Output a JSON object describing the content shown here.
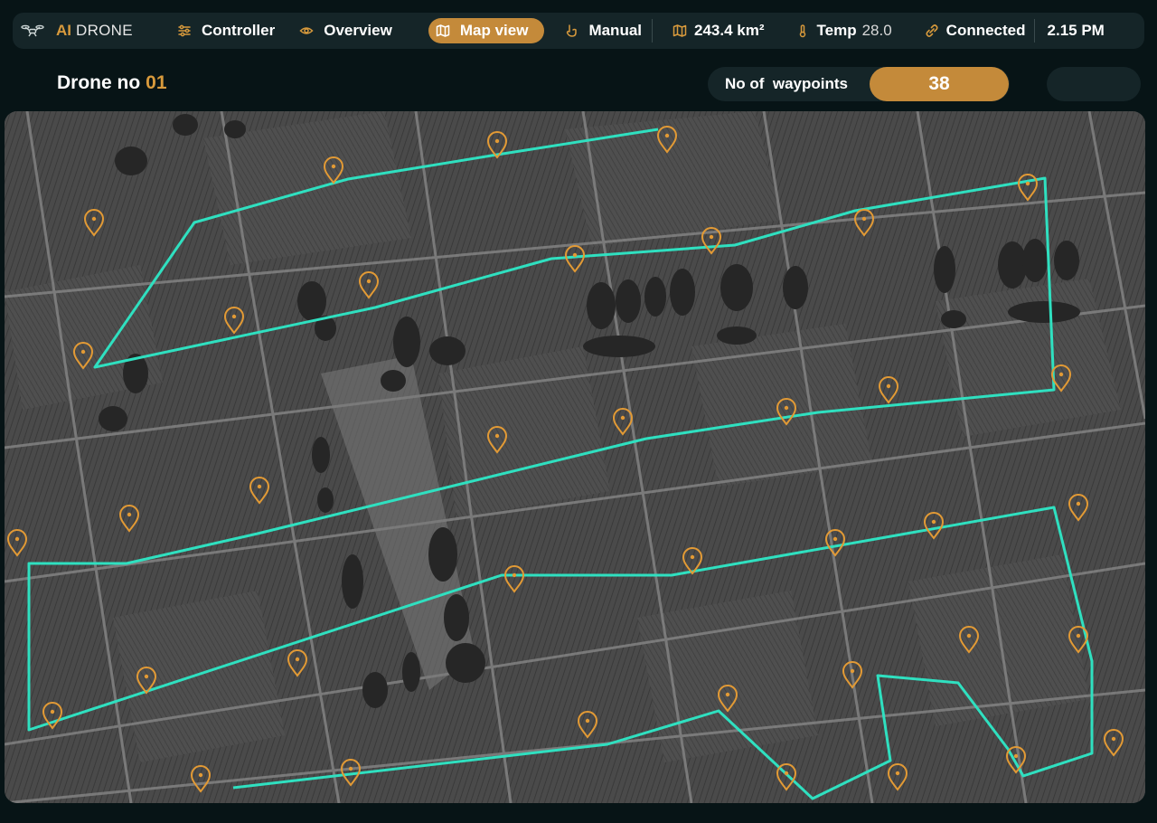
{
  "brand": {
    "ai": "AI",
    "drone": "DRONE",
    "logo_icon": "drone-icon"
  },
  "nav": {
    "controller": {
      "label": "Controller",
      "icon": "sliders-icon"
    },
    "overview": {
      "label": "Overview",
      "icon": "eye-icon"
    },
    "map_view": {
      "label": "Map view",
      "icon": "map-icon",
      "active": true
    },
    "manual": {
      "label": "Manual",
      "icon": "hand-icon"
    }
  },
  "status": {
    "area": "243.4 km²",
    "temp_label": "Temp",
    "temp_value": "28.0",
    "connection": "Connected",
    "time": "2.15 PM"
  },
  "drone": {
    "label": "Drone no",
    "number": "01"
  },
  "waypoints": {
    "label": "No of  waypoints",
    "count": "38"
  },
  "colors": {
    "accent": "#c48a3a",
    "marker": "#e29a35",
    "path": "#2fe0c0",
    "panel": "#152528",
    "bg": "#071416"
  }
}
